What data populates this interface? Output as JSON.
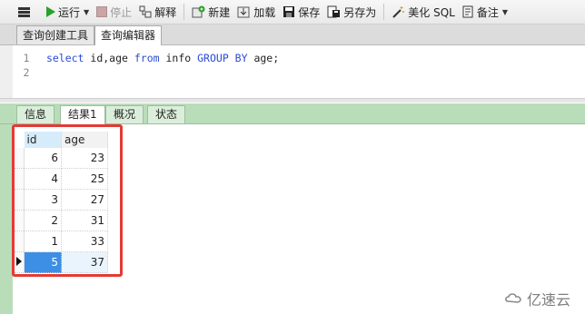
{
  "toolbar": {
    "run": "运行",
    "stop": "停止",
    "explain": "解释",
    "new": "新建",
    "load": "加载",
    "save": "保存",
    "save_as": "另存为",
    "beautify_sql": "美化 SQL",
    "notes": "备注"
  },
  "editor_tabs": [
    "查询创建工具",
    "查询编辑器"
  ],
  "editor": {
    "lines": [
      {
        "number": "1",
        "tokens": [
          {
            "text": "select",
            "kw": true
          },
          {
            "text": " id,age ",
            "kw": false
          },
          {
            "text": "from",
            "kw": true
          },
          {
            "text": " info ",
            "kw": false
          },
          {
            "text": "GROUP BY",
            "kw": true
          },
          {
            "text": " age;",
            "kw": false
          }
        ]
      },
      {
        "number": "2",
        "tokens": []
      }
    ]
  },
  "result_tabs": [
    "信息",
    "结果1",
    "概况",
    "状态"
  ],
  "results": {
    "columns": [
      "id",
      "age"
    ],
    "rows": [
      [
        "6",
        "23"
      ],
      [
        "4",
        "25"
      ],
      [
        "3",
        "27"
      ],
      [
        "2",
        "31"
      ],
      [
        "1",
        "33"
      ],
      [
        "5",
        "37"
      ]
    ],
    "current_row": 5
  },
  "watermark": "亿速云",
  "colors": {
    "keyword": "#2a4bd7",
    "run_green": "#2aa12a",
    "tab_green": "#b9ddb9",
    "selection_blue": "#3d8fe6",
    "highlight_red": "#e53935"
  }
}
